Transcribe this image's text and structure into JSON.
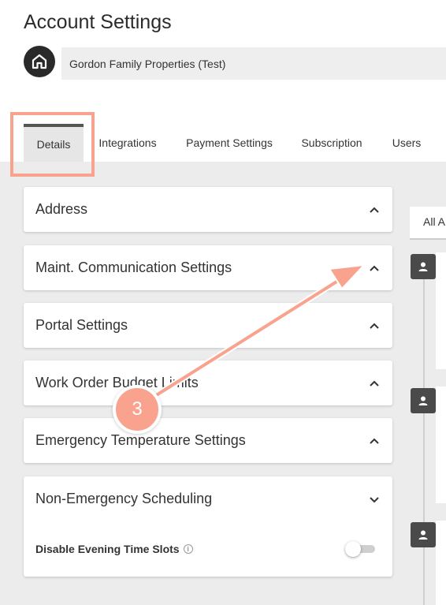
{
  "header": {
    "title": "Account Settings",
    "account_name": "Gordon Family Properties (Test)"
  },
  "tabs": [
    {
      "label": "Details",
      "active": true
    },
    {
      "label": "Integrations",
      "active": false
    },
    {
      "label": "Payment Settings",
      "active": false
    },
    {
      "label": "Subscription",
      "active": false
    },
    {
      "label": "Users",
      "active": false
    }
  ],
  "sections": [
    {
      "label": "Address",
      "expanded": false
    },
    {
      "label": "Maint. Communication Settings",
      "expanded": false
    },
    {
      "label": "Portal Settings",
      "expanded": false
    },
    {
      "label": "Work Order Budget Limits",
      "expanded": false
    },
    {
      "label": "Emergency Temperature Settings",
      "expanded": false
    },
    {
      "label": "Non-Emergency Scheduling",
      "expanded": true
    }
  ],
  "non_emergency": {
    "setting_label": "Disable Evening Time Slots",
    "setting_enabled": false
  },
  "right_panel": {
    "tab_label": "All A"
  },
  "annotation": {
    "step_number": "3",
    "color": "#f9a38e"
  },
  "icons": {
    "logo": "home-icon",
    "collapsed_chevron": "chevron-up-icon",
    "expanded_chevron": "chevron-down-icon",
    "info": "info-icon",
    "avatar": "person-icon"
  }
}
